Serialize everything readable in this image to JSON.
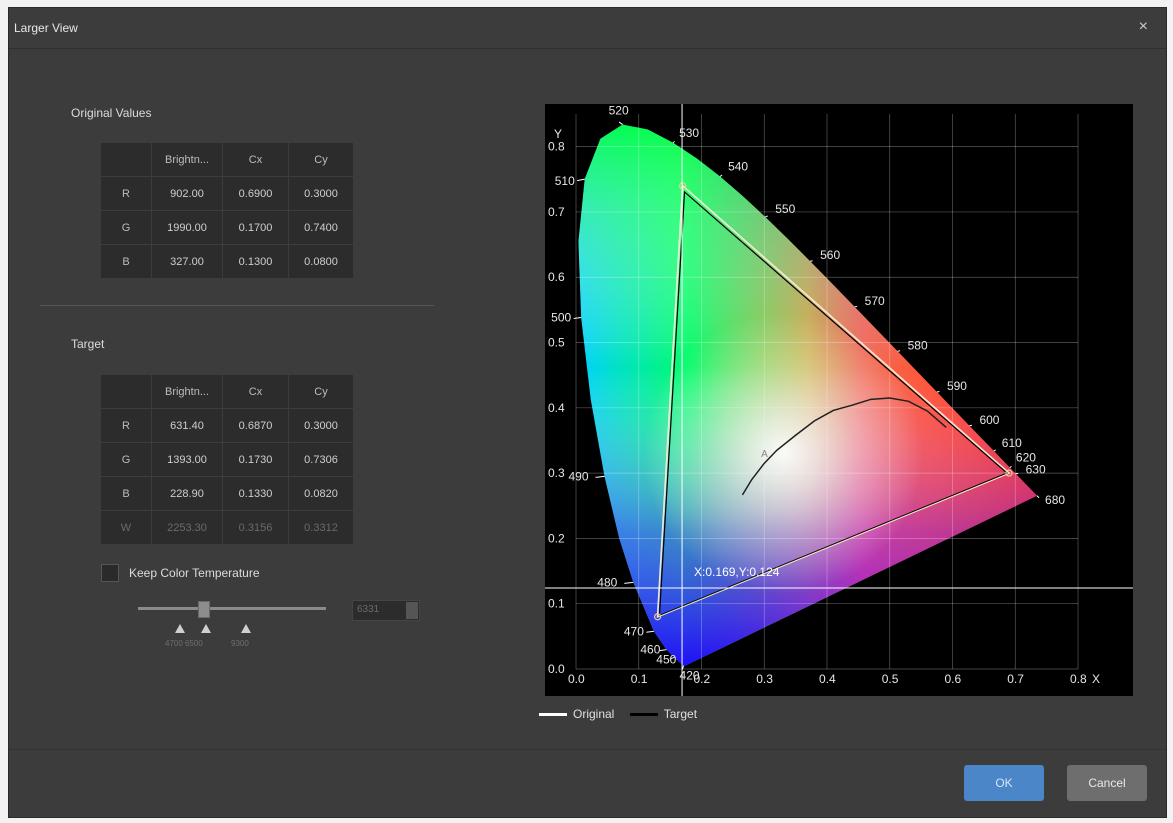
{
  "dialog": {
    "title": "Larger View",
    "close": "×"
  },
  "original": {
    "label": "Original Values",
    "headers": [
      "Brightn...",
      "Cx",
      "Cy"
    ],
    "rows": [
      {
        "name": "R",
        "brightness": "902.00",
        "cx": "0.6900",
        "cy": "0.3000"
      },
      {
        "name": "G",
        "brightness": "1990.00",
        "cx": "0.1700",
        "cy": "0.7400"
      },
      {
        "name": "B",
        "brightness": "327.00",
        "cx": "0.1300",
        "cy": "0.0800"
      }
    ]
  },
  "target": {
    "label": "Target",
    "headers": [
      "Brightn...",
      "Cx",
      "Cy"
    ],
    "rows": [
      {
        "name": "R",
        "brightness": "631.40",
        "cx": "0.6870",
        "cy": "0.3000"
      },
      {
        "name": "G",
        "brightness": "1393.00",
        "cx": "0.1730",
        "cy": "0.7306"
      },
      {
        "name": "B",
        "brightness": "228.90",
        "cx": "0.1330",
        "cy": "0.0820"
      },
      {
        "name": "W",
        "brightness": "2253.30",
        "cx": "0.3156",
        "cy": "0.3312"
      }
    ]
  },
  "keep_color_temp": {
    "label": "Keep Color Temperature",
    "checked": false
  },
  "temp_slider": {
    "value": "6331",
    "ticks": [
      "4700",
      "6500",
      "9300"
    ]
  },
  "chart_data": {
    "type": "scatter",
    "xlabel": "X",
    "ylabel": "Y",
    "xlim": [
      0,
      0.8
    ],
    "ylim": [
      0,
      0.85
    ],
    "xticks": [
      "0.0",
      "0.1",
      "0.2",
      "0.3",
      "0.4",
      "0.5",
      "0.6",
      "0.7",
      "0.8"
    ],
    "yticks": [
      "0.0",
      "0.1",
      "0.2",
      "0.3",
      "0.4",
      "0.5",
      "0.6",
      "0.7",
      "0.8"
    ],
    "wavelength_labels": [
      "420",
      "450",
      "460",
      "470",
      "480",
      "490",
      "500",
      "510",
      "520",
      "530",
      "540",
      "550",
      "560",
      "570",
      "580",
      "590",
      "600",
      "610",
      "620",
      "630",
      "680"
    ],
    "cursor_readout": "X:0.169,Y:0.124",
    "planckian_label": "A",
    "series": [
      {
        "name": "Original",
        "points": [
          [
            0.69,
            0.3
          ],
          [
            0.17,
            0.74
          ],
          [
            0.13,
            0.08
          ]
        ]
      },
      {
        "name": "Target",
        "points": [
          [
            0.687,
            0.3
          ],
          [
            0.173,
            0.7306
          ],
          [
            0.133,
            0.082
          ]
        ]
      }
    ],
    "white_point": [
      0.3156,
      0.3312
    ],
    "cursor": [
      0.169,
      0.124
    ],
    "colors": {
      "original": "#ffffff",
      "target": "#000000",
      "triangle": "#e8d08a"
    }
  },
  "legend": {
    "original": "Original",
    "target": "Target"
  },
  "buttons": {
    "ok": "OK",
    "cancel": "Cancel"
  }
}
